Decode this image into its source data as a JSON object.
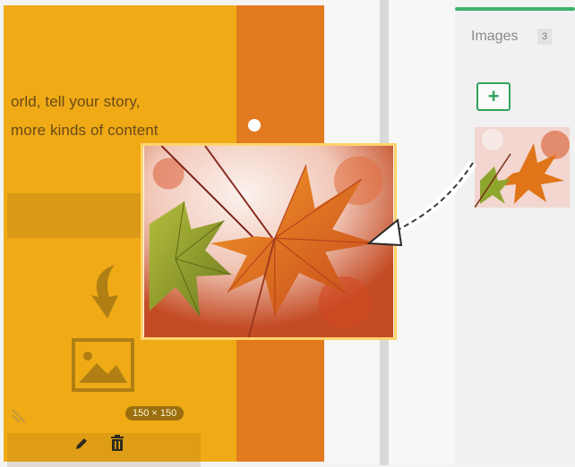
{
  "content": {
    "text_line_1": "orld, tell your story,",
    "text_line_2": "more kinds of content",
    "size_badge": "150 × 150"
  },
  "panel": {
    "title": "Images",
    "count": "3",
    "add_label": "+"
  },
  "icons": {
    "placeholder": "image-placeholder-icon",
    "edit": "pencil-icon",
    "delete": "trash-icon",
    "add": "plus-icon",
    "rotate": "rotate-icon"
  },
  "colors": {
    "content_yellow": "#efaa16",
    "content_orange": "#e27a20",
    "accent_green": "#3ab36b",
    "drag_border": "#ffd36b"
  }
}
